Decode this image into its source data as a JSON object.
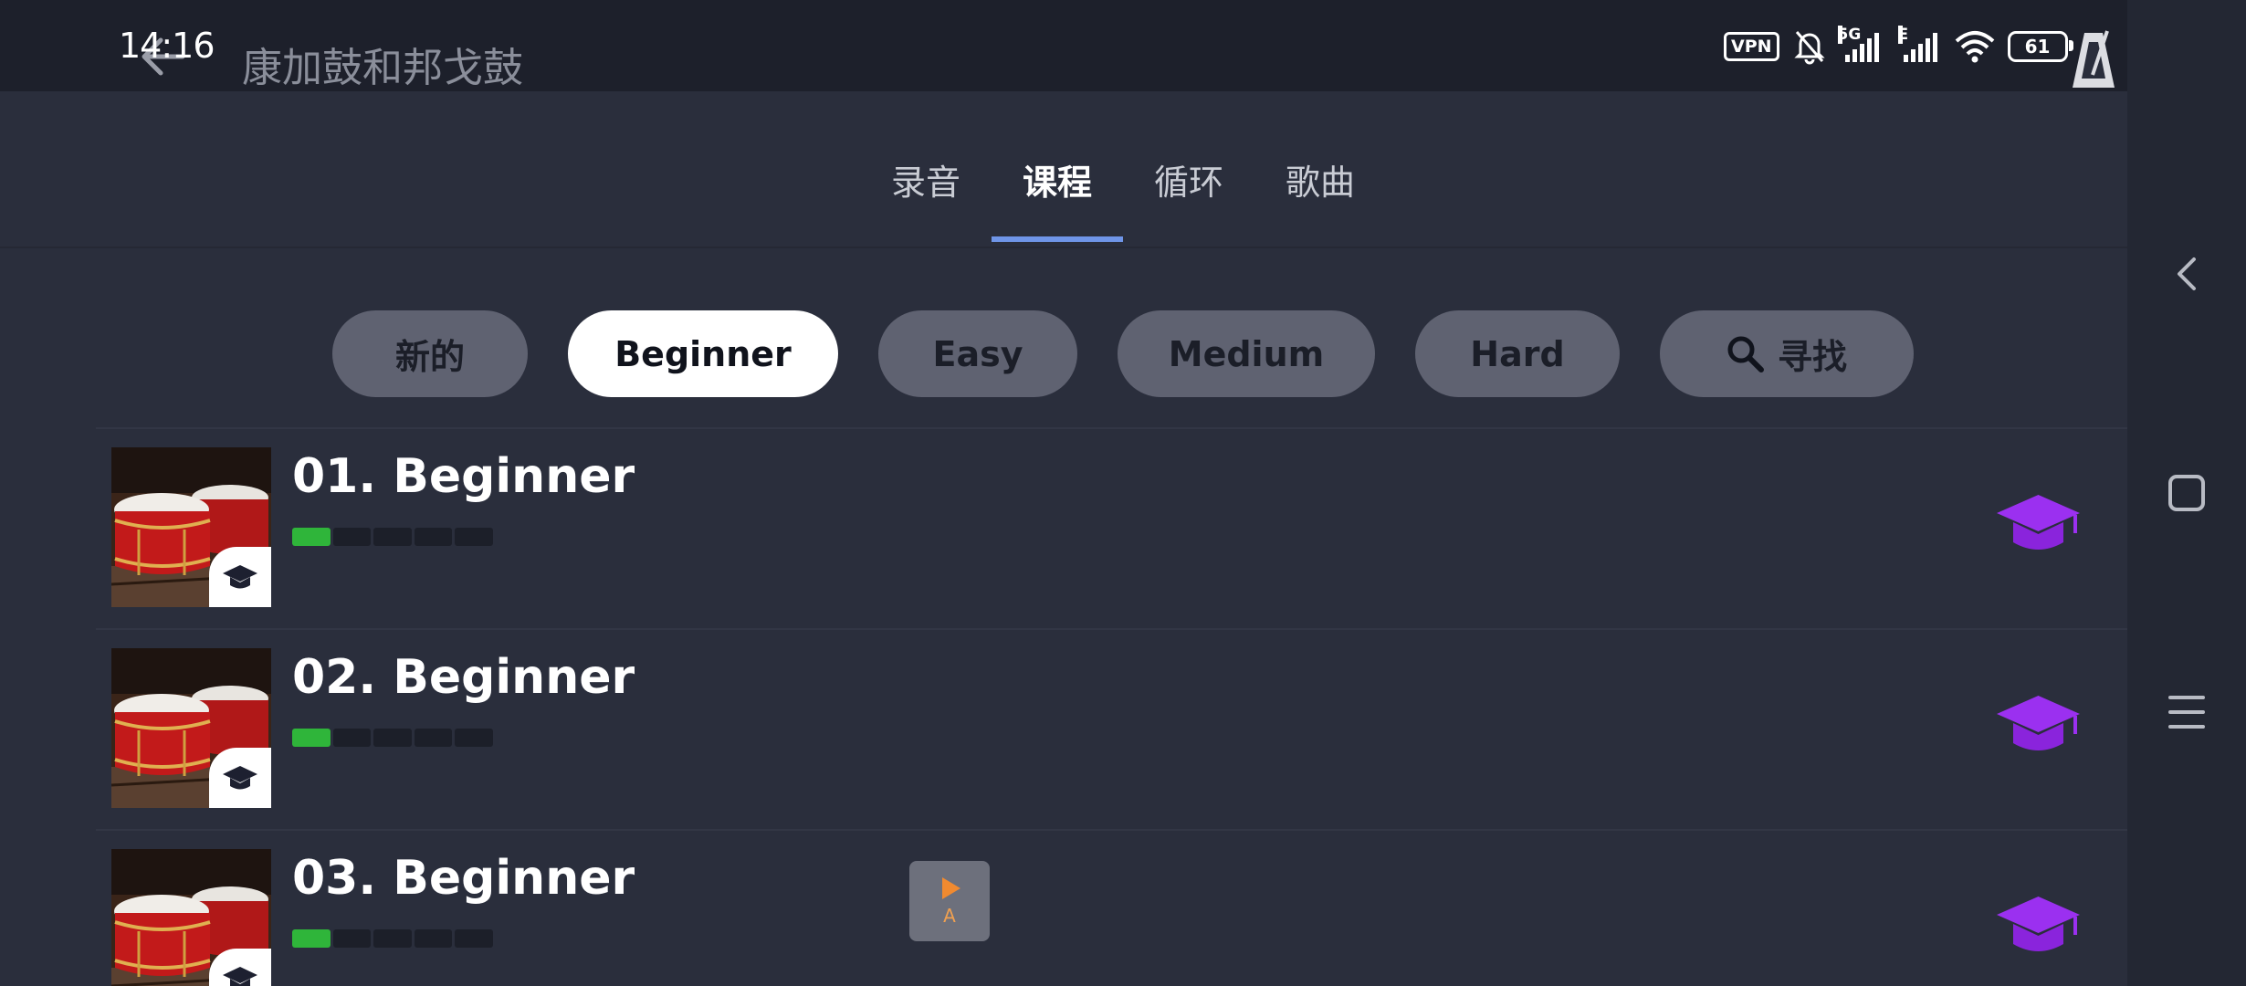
{
  "status_bar": {
    "time": "14:16",
    "vpn": "VPN",
    "signal1_label": "5G",
    "signal2_label": "E",
    "battery": "61"
  },
  "header": {
    "title": "康加鼓和邦戈鼓"
  },
  "tabs": [
    {
      "label": "录音",
      "active": false
    },
    {
      "label": "课程",
      "active": true
    },
    {
      "label": "循环",
      "active": false
    },
    {
      "label": "歌曲",
      "active": false
    }
  ],
  "filters": [
    {
      "label": "新的",
      "active": false
    },
    {
      "label": "Beginner",
      "active": true
    },
    {
      "label": "Easy",
      "active": false
    },
    {
      "label": "Medium",
      "active": false
    },
    {
      "label": "Hard",
      "active": false
    },
    {
      "label": "寻找",
      "icon": "search-icon",
      "active": false
    }
  ],
  "lessons": [
    {
      "title": "01. Beginner",
      "progress_segments": 5,
      "progress_done": 1
    },
    {
      "title": "02. Beginner",
      "progress_segments": 5,
      "progress_done": 1
    },
    {
      "title": "03. Beginner",
      "progress_segments": 5,
      "progress_done": 1
    }
  ],
  "floating_widget": {
    "label": "A"
  },
  "colors": {
    "background": "#2a2e3c",
    "topbar": "#1d202b",
    "tab_indicator": "#6f95e8",
    "chip": "#5f6271",
    "chip_active": "#ffffff",
    "progress_done": "#2fb53a",
    "cap_icon": "#9b30f0"
  }
}
